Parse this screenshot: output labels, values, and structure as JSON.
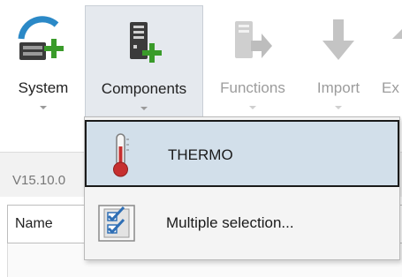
{
  "ribbon": {
    "buttons": [
      {
        "label": "System",
        "icon": "system-add-icon",
        "enabled": true
      },
      {
        "label": "Components",
        "icon": "components-add-icon",
        "enabled": true,
        "pressed": true
      },
      {
        "label": "Functions",
        "icon": "functions-arrow-icon",
        "enabled": false
      },
      {
        "label": "Import",
        "icon": "import-arrow-icon",
        "enabled": false
      },
      {
        "label": "Ex",
        "icon": "export-icon",
        "enabled": false
      }
    ]
  },
  "status": {
    "version": "V15.10.0"
  },
  "table": {
    "name_header": "Name"
  },
  "dropdown": {
    "items": [
      {
        "label": "THERMO",
        "icon": "thermometer-icon",
        "highlighted": true
      },
      {
        "label": "Multiple selection...",
        "icon": "checklist-icon",
        "highlighted": false
      }
    ]
  },
  "colors": {
    "accent_green": "#3a9b2a",
    "highlight": "#d2dfea",
    "thermo_red": "#c62f2f",
    "check_blue": "#2f6fb5"
  }
}
